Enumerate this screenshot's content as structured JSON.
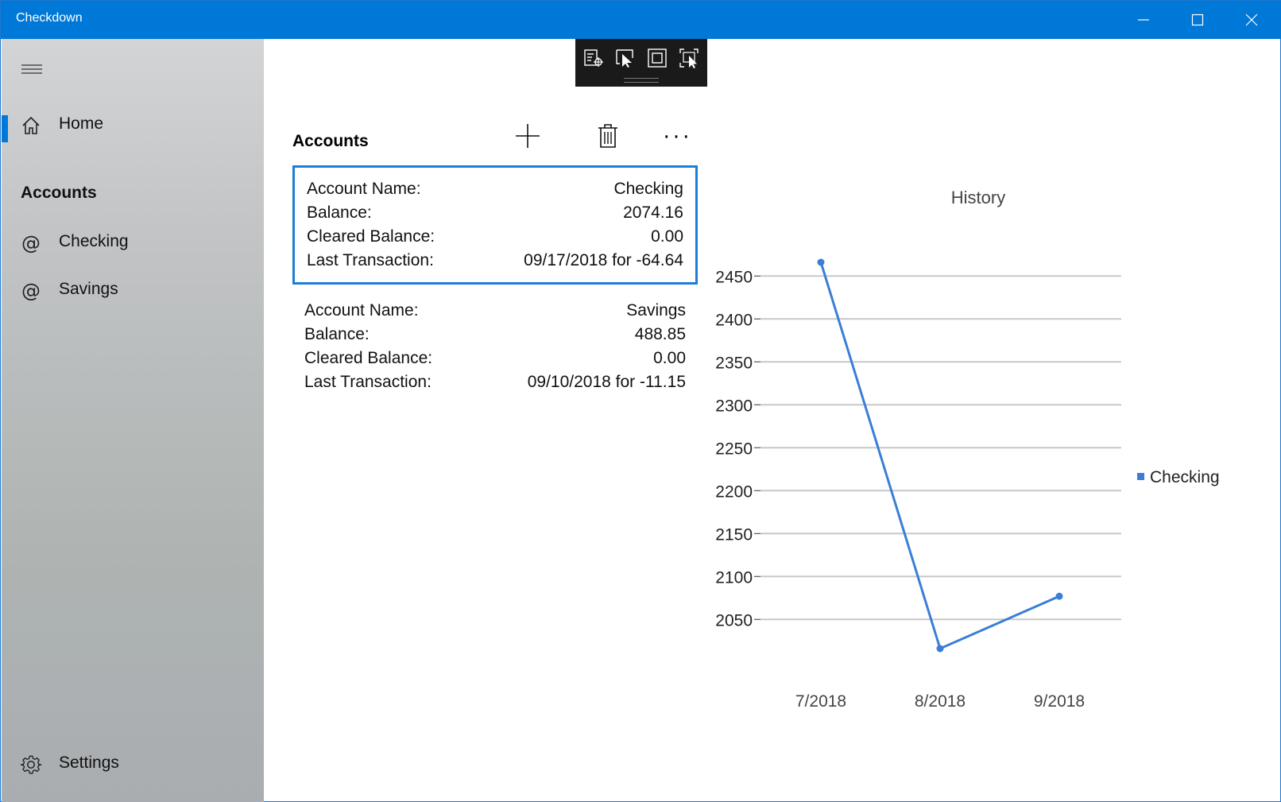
{
  "window": {
    "title": "Checkdown",
    "minimize_icon": "minimize-icon",
    "maximize_icon": "maximize-icon",
    "close_icon": "close-icon"
  },
  "sidebar": {
    "menu_icon": "hamburger-icon",
    "home_label": "Home",
    "section_header": "Accounts",
    "items": [
      {
        "label": "Checking",
        "icon": "at-sign-icon"
      },
      {
        "label": "Savings",
        "icon": "at-sign-icon"
      }
    ],
    "settings_label": "Settings",
    "accent_color": "#0078d7"
  },
  "debug_toolbar": {
    "buttons": [
      "live-visual-tree-icon",
      "select-element-icon",
      "display-layout-adorners-icon",
      "track-focused-element-icon"
    ]
  },
  "accounts": {
    "title": "Accounts",
    "commands": [
      "add-icon",
      "delete-icon",
      "more-icon"
    ],
    "more_label": "···",
    "list": [
      {
        "name_label": "Account Name:",
        "name": "Checking",
        "balance_label": "Balance:",
        "balance": "2074.16",
        "cleared_label": "Cleared Balance:",
        "cleared": "0.00",
        "last_label": "Last Transaction:",
        "last": "09/17/2018 for -64.64",
        "selected": true
      },
      {
        "name_label": "Account Name:",
        "name": "Savings",
        "balance_label": "Balance:",
        "balance": "488.85",
        "cleared_label": "Cleared Balance:",
        "cleared": "0.00",
        "last_label": "Last Transaction:",
        "last": "09/10/2018 for -11.15",
        "selected": false
      }
    ]
  },
  "chart_data": {
    "type": "line",
    "title": "History",
    "xlabel": "",
    "ylabel": "",
    "categories": [
      "7/2018",
      "8/2018",
      "9/2018"
    ],
    "y_ticks": [
      2050,
      2100,
      2150,
      2200,
      2250,
      2300,
      2350,
      2400,
      2450
    ],
    "ylim": [
      2016,
      2466
    ],
    "grid": true,
    "legend": "right",
    "series": [
      {
        "name": "Checking",
        "values": [
          2466,
          2016,
          2077
        ],
        "color": "#3a7ed6"
      }
    ]
  }
}
